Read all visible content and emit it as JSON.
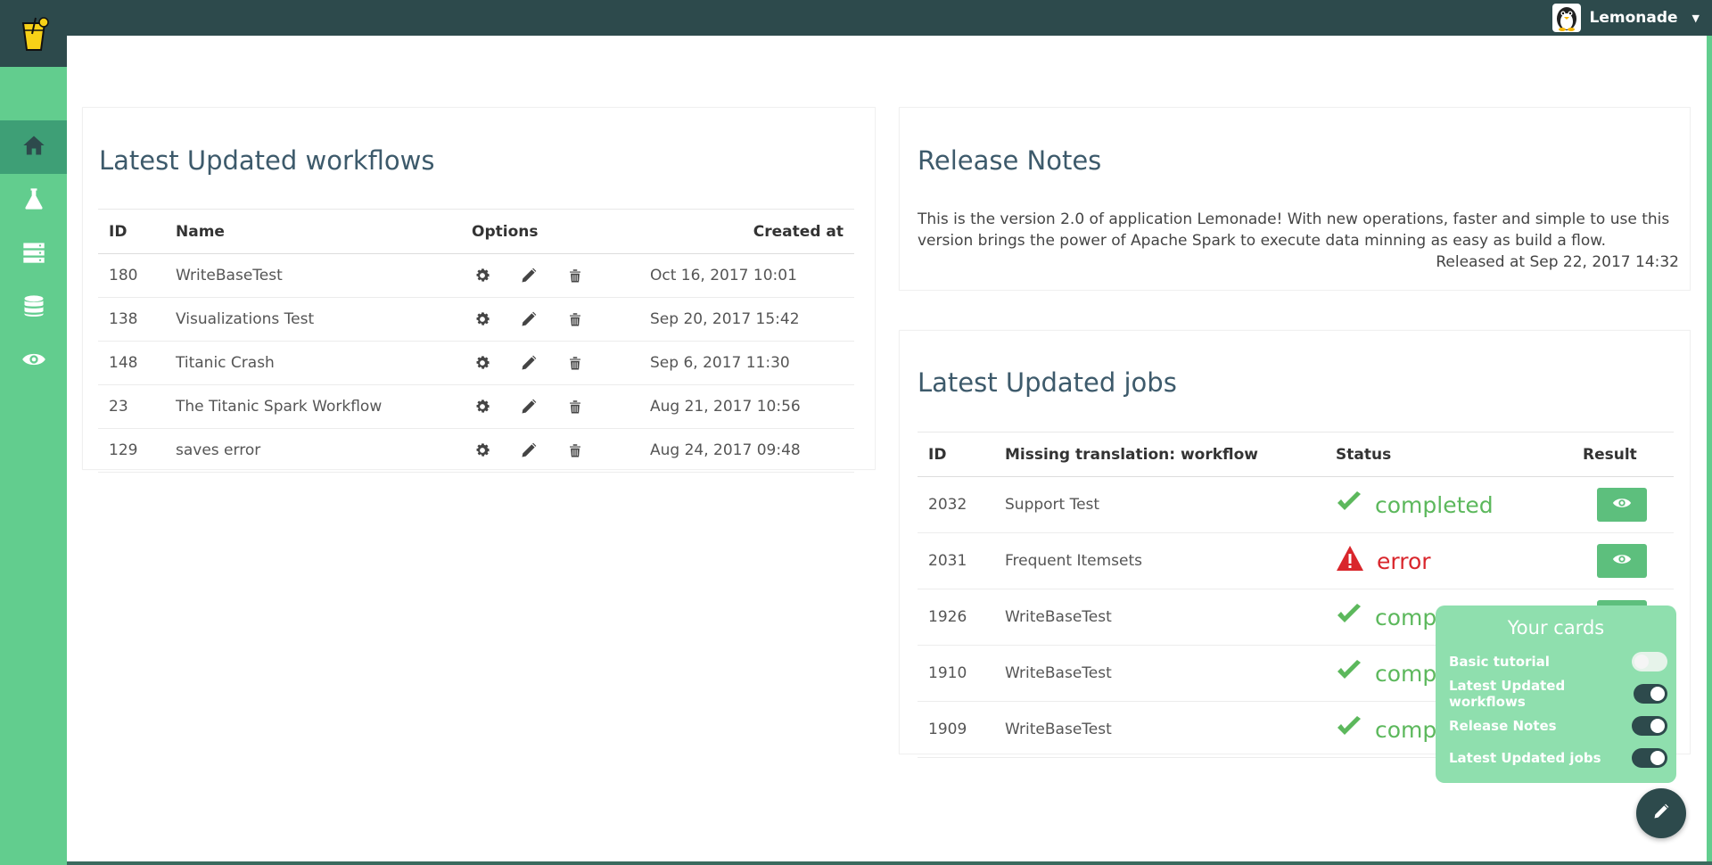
{
  "app": {
    "name": "Lemonade"
  },
  "colors": {
    "topbar": "#2d4a4c",
    "sidebar": "#62cd8e",
    "accent_active": "#3e9f76",
    "completed": "#5cb85c",
    "error": "#d9262c"
  },
  "user": {
    "name": "Lemonade",
    "avatar_icon": "penguin-avatar-icon"
  },
  "sidebar": {
    "items": [
      {
        "icon": "home-icon",
        "active": true
      },
      {
        "icon": "flask-icon",
        "active": false
      },
      {
        "icon": "storage-icon",
        "active": false
      },
      {
        "icon": "database-icon",
        "active": false
      },
      {
        "icon": "eye-icon",
        "active": false
      }
    ]
  },
  "workflows": {
    "title": "Latest Updated workflows",
    "headers": {
      "id": "ID",
      "name": "Name",
      "options": "Options",
      "created": "Created at"
    },
    "rows": [
      {
        "id": "180",
        "name": "WriteBaseTest",
        "created": "Oct 16, 2017 10:01"
      },
      {
        "id": "138",
        "name": "Visualizations Test",
        "created": "Sep 20, 2017 15:42"
      },
      {
        "id": "148",
        "name": "Titanic Crash",
        "created": "Sep 6, 2017 11:30"
      },
      {
        "id": "23",
        "name": "The Titanic Spark Workflow",
        "created": "Aug 21, 2017 10:56"
      },
      {
        "id": "129",
        "name": "saves error",
        "created": "Aug 24, 2017 09:48"
      }
    ]
  },
  "release": {
    "title": "Release Notes",
    "text": "This is the version 2.0 of application Lemonade! With new operations, faster and simple to use this version brings the power of Apache Spark to execute data minning as easy as build a flow.",
    "released_at": "Released at Sep 22, 2017 14:32"
  },
  "jobs": {
    "title": "Latest Updated jobs",
    "headers": {
      "id": "ID",
      "workflow": "Missing translation: workflow",
      "status": "Status",
      "result": "Result"
    },
    "rows": [
      {
        "id": "2032",
        "workflow": "Support Test",
        "status": "completed"
      },
      {
        "id": "2031",
        "workflow": "Frequent Itemsets",
        "status": "error"
      },
      {
        "id": "1926",
        "workflow": "WriteBaseTest",
        "status": "completed"
      },
      {
        "id": "1910",
        "workflow": "WriteBaseTest",
        "status": "compl"
      },
      {
        "id": "1909",
        "workflow": "WriteBaseTest",
        "status": "compl"
      }
    ]
  },
  "cards_panel": {
    "title": "Your cards",
    "toggles": [
      {
        "label": "Basic tutorial",
        "on": false
      },
      {
        "label": "Latest Updated workflows",
        "on": true
      },
      {
        "label": "Release Notes",
        "on": true
      },
      {
        "label": "Latest Updated jobs",
        "on": true
      }
    ]
  },
  "fab": {
    "icon": "pencil-icon"
  }
}
